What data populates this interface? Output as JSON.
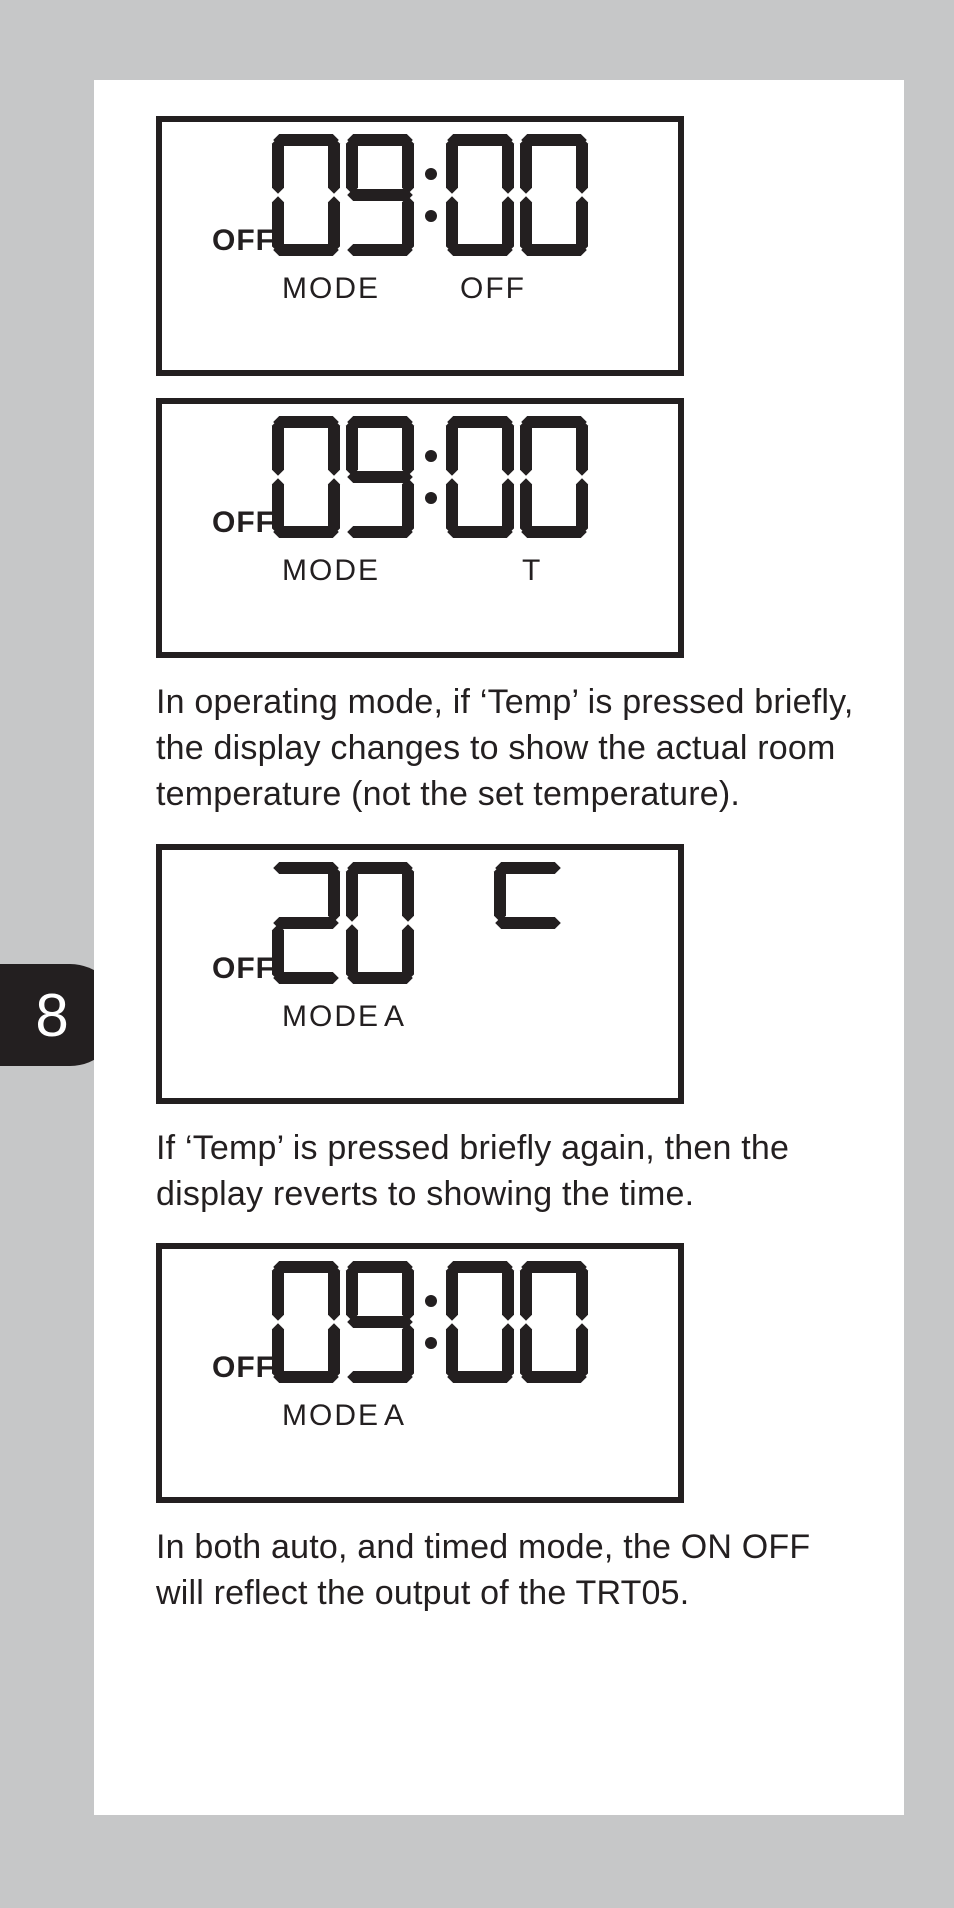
{
  "page_number": "8",
  "lcd1": {
    "off": "OFF",
    "mode": "MODE",
    "right": "OFF",
    "digits": "09:00"
  },
  "lcd2": {
    "off": "OFF",
    "mode": "MODE",
    "right": "T",
    "digits": "09:00"
  },
  "para1": "In operating mode, if ‘Temp’ is pressed briefly, the display changes to show the actual room temperature (not the set temperature).",
  "lcd3": {
    "off": "OFF",
    "mode": "MODE",
    "right": "A",
    "digits": "20°c"
  },
  "para2": "If ‘Temp’ is pressed briefly again, then the display reverts to showing the time.",
  "lcd4": {
    "off": "OFF",
    "mode": "MODE",
    "right": "A",
    "digits": "09:00"
  },
  "para3": "In both auto, and timed mode, the ON OFF will reflect the output of the TRT05."
}
